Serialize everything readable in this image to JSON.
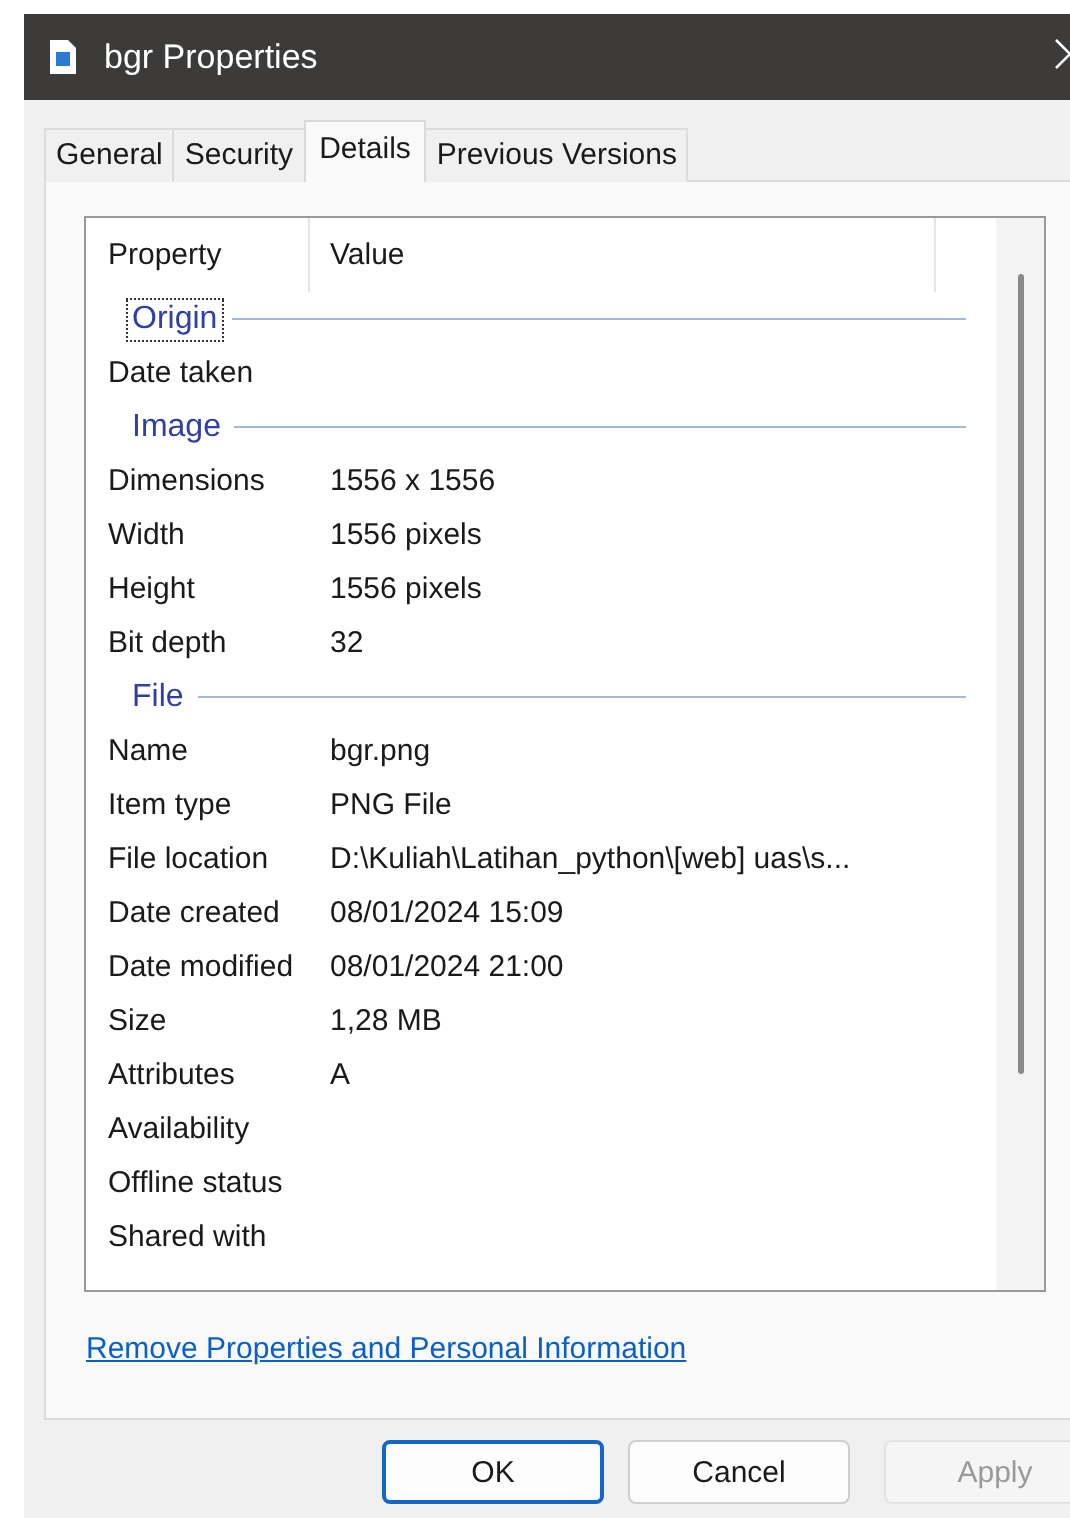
{
  "window": {
    "title": "bgr Properties"
  },
  "tabs": [
    {
      "label": "General",
      "selected": false
    },
    {
      "label": "Security",
      "selected": false
    },
    {
      "label": "Details",
      "selected": true
    },
    {
      "label": "Previous Versions",
      "selected": false
    }
  ],
  "table": {
    "columns": [
      "Property",
      "Value"
    ],
    "rows": [
      {
        "kind": "group",
        "label": "Origin",
        "focused": true
      },
      {
        "kind": "property",
        "property": "Date taken"
      },
      {
        "kind": "group",
        "label": "Image",
        "focused": false
      },
      {
        "kind": "property",
        "property": "Dimensions",
        "value": "1556 x 1556"
      },
      {
        "kind": "property",
        "property": "Width",
        "value": "1556 pixels"
      },
      {
        "kind": "property",
        "property": "Height",
        "value": "1556 pixels"
      },
      {
        "kind": "property",
        "property": "Bit depth",
        "value": "32"
      },
      {
        "kind": "group",
        "label": "File",
        "focused": false
      },
      {
        "kind": "property",
        "property": "Name",
        "value": "bgr.png"
      },
      {
        "kind": "property",
        "property": "Item type",
        "value": "PNG File"
      },
      {
        "kind": "property",
        "property": "File location",
        "value": "D:\\Kuliah\\Latihan_python\\[web] uas\\s..."
      },
      {
        "kind": "property",
        "property": "Date created",
        "value": "08/01/2024 15:09"
      },
      {
        "kind": "property",
        "property": "Date modified",
        "value": "08/01/2024 21:00"
      },
      {
        "kind": "property",
        "property": "Size",
        "value": "1,28 MB"
      },
      {
        "kind": "property",
        "property": "Attributes",
        "value": "A"
      },
      {
        "kind": "property",
        "property": "Availability"
      },
      {
        "kind": "property",
        "property": "Offline status"
      },
      {
        "kind": "property",
        "property": "Shared with"
      }
    ]
  },
  "link": "Remove Properties and Personal Information",
  "buttons": [
    {
      "label": "OK",
      "default": true,
      "disabled": false
    },
    {
      "label": "Cancel",
      "default": false,
      "disabled": false
    },
    {
      "label": "Apply",
      "default": false,
      "disabled": true
    }
  ]
}
